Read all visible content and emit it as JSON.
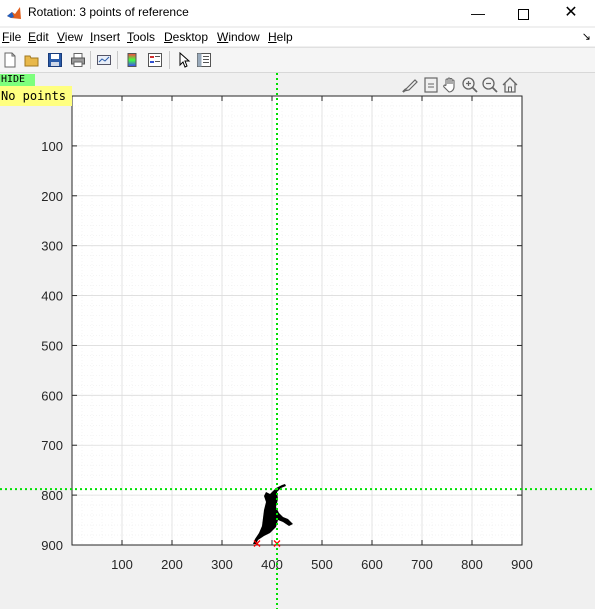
{
  "window": {
    "title": "Rotation: 3 points of reference",
    "minimize_glyph": "—",
    "close_glyph": "✕"
  },
  "menu": [
    {
      "label": "File",
      "mnemonic": "F",
      "rest": "ile"
    },
    {
      "label": "Edit",
      "mnemonic": "E",
      "rest": "dit"
    },
    {
      "label": "View",
      "mnemonic": "V",
      "rest": "iew"
    },
    {
      "label": "Insert",
      "mnemonic": "I",
      "rest": "nsert"
    },
    {
      "label": "Tools",
      "mnemonic": "T",
      "rest": "ools"
    },
    {
      "label": "Desktop",
      "mnemonic": "D",
      "rest": "esktop"
    },
    {
      "label": "Window",
      "mnemonic": "W",
      "rest": "indow"
    },
    {
      "label": "Help",
      "mnemonic": "H",
      "rest": "elp"
    }
  ],
  "toolbar_icons": [
    "new-figure-icon",
    "open-file-icon",
    "save-icon",
    "print-icon",
    "link-plot-icon",
    "colorbar-icon",
    "legend-icon",
    "select-pointer-icon",
    "property-inspector-icon"
  ],
  "axes_toolbar_icons": [
    "brush-icon",
    "data-tips-icon",
    "pan-hand-icon",
    "zoom-in-icon",
    "zoom-out-icon",
    "home-restore-icon"
  ],
  "hide_button": "HIDE",
  "points_status": "No points",
  "chart_data": {
    "type": "image",
    "x_ticks": [
      "100",
      "200",
      "300",
      "400",
      "500",
      "600",
      "700",
      "800",
      "900"
    ],
    "y_ticks": [
      "100",
      "200",
      "300",
      "400",
      "500",
      "600",
      "700",
      "800",
      "900"
    ],
    "xlim": [
      0,
      900
    ],
    "ylim": [
      0,
      900
    ],
    "y_direction": "reversed",
    "grid": "on (major and minor)",
    "crosshair": {
      "x": 410,
      "y": 788,
      "color": "#00e000"
    },
    "reference_markers": [
      {
        "x": 370,
        "y": 897,
        "color": "#ff0000"
      },
      {
        "x": 410,
        "y": 897,
        "color": "#ff0000"
      }
    ]
  }
}
